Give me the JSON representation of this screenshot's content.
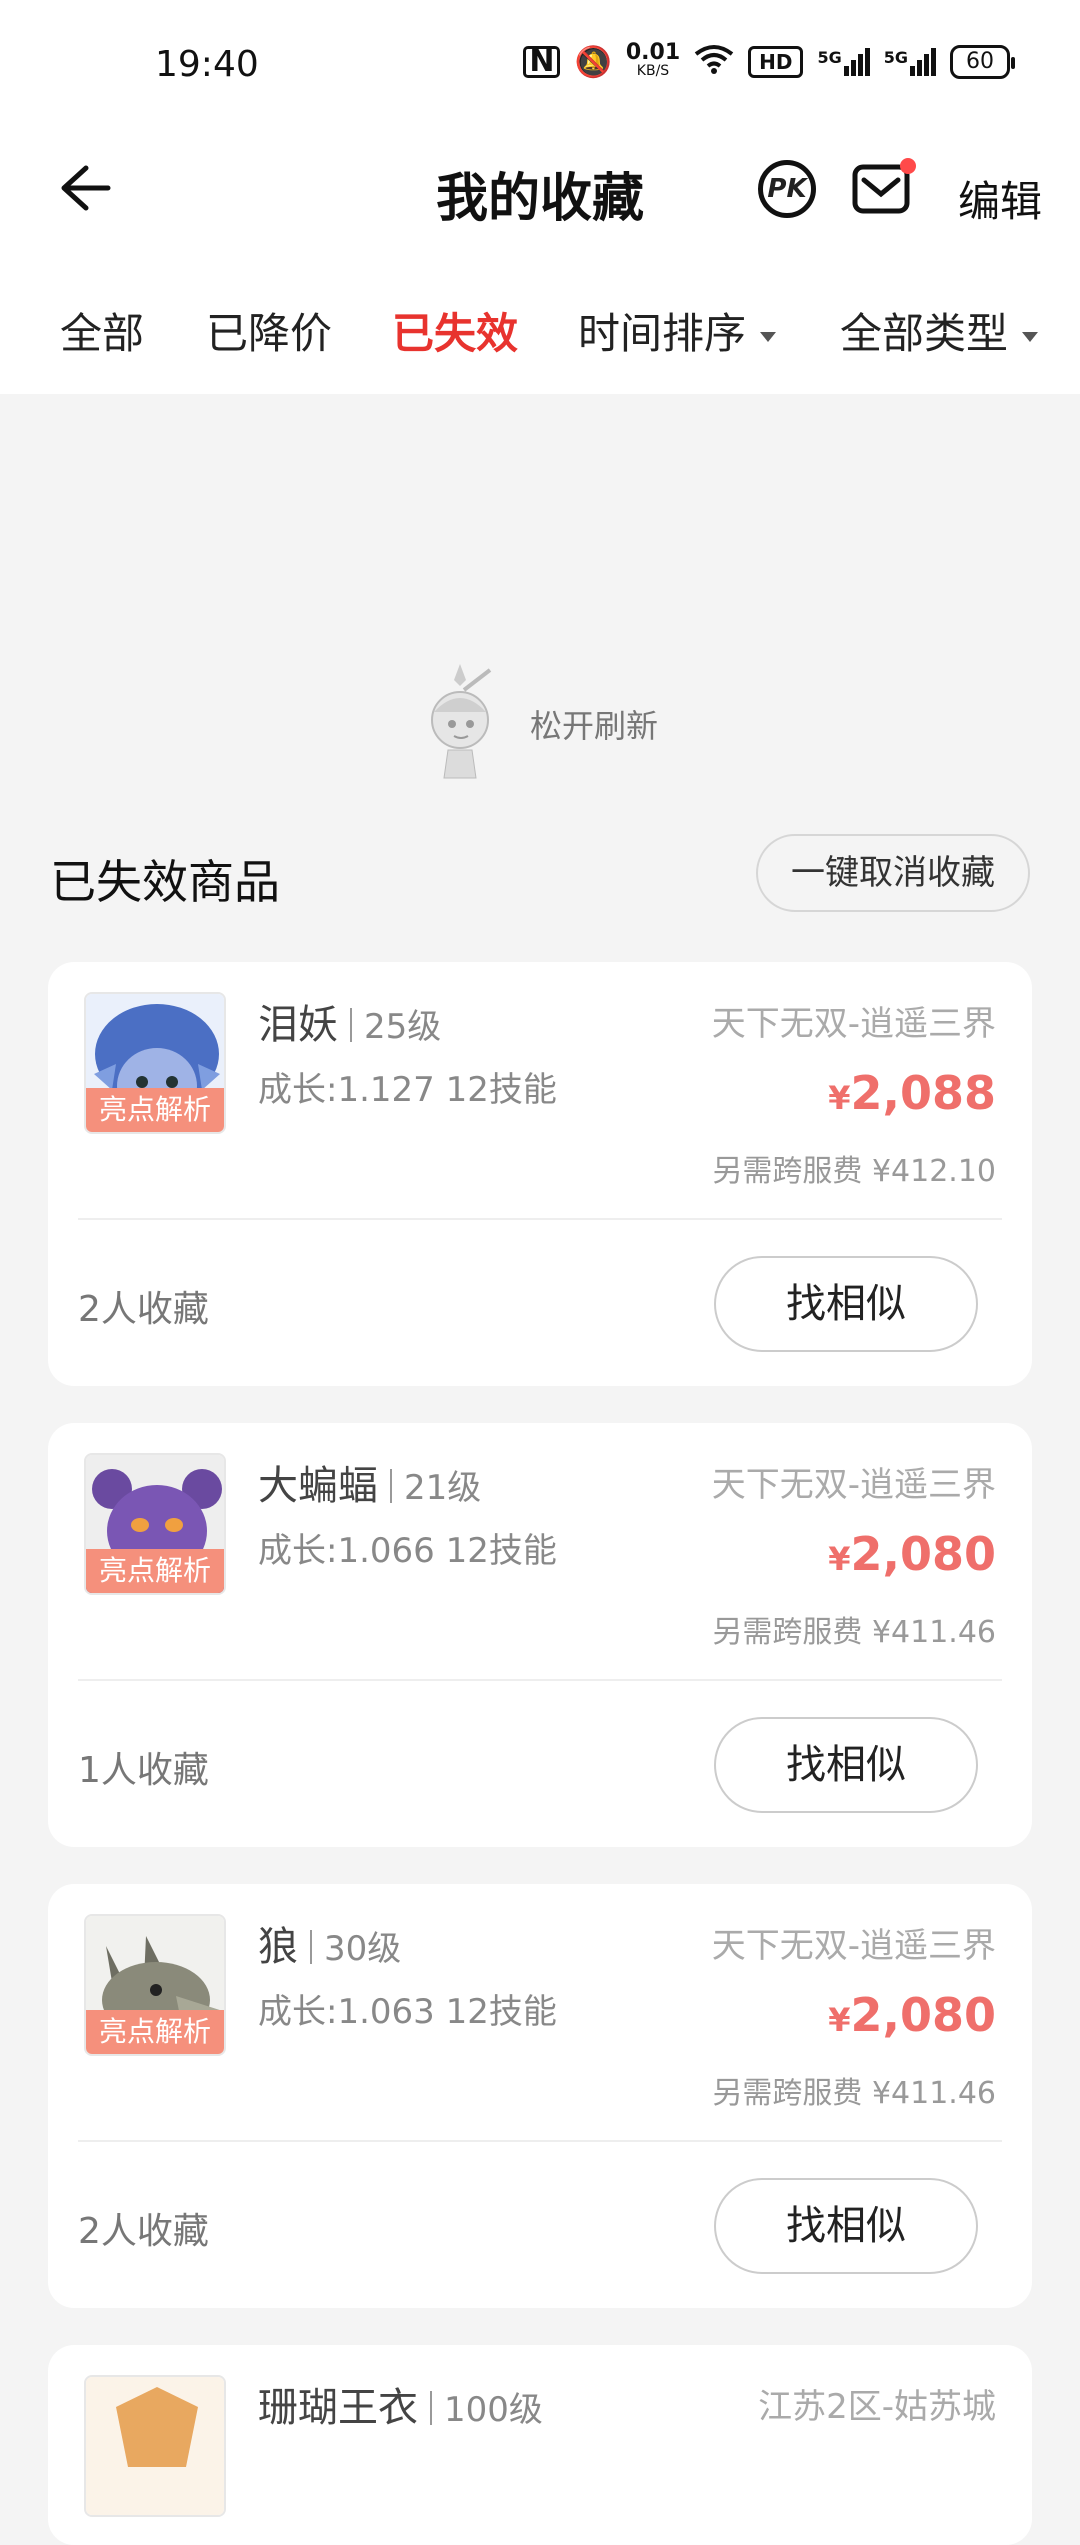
{
  "status_bar": {
    "time": "19:40",
    "net_speed_value": "0.01",
    "net_speed_unit": "KB/S",
    "hd_label": "HD",
    "signal1": "5G",
    "signal2": "5G",
    "battery": "60"
  },
  "header": {
    "title": "我的收藏",
    "pk_label": "PK",
    "edit_label": "编辑"
  },
  "tabs": [
    {
      "label": "全部",
      "active": false
    },
    {
      "label": "已降价",
      "active": false
    },
    {
      "label": "已失效",
      "active": true
    },
    {
      "label": "时间排序",
      "dropdown": true
    },
    {
      "label": "全部类型",
      "dropdown": true
    }
  ],
  "refresh": {
    "text": "松开刷新"
  },
  "section": {
    "title": "已失效商品",
    "cancel_all_label": "一键取消收藏"
  },
  "items": [
    {
      "name": "泪妖",
      "level": "25级",
      "stats": "成长:1.127 12技能",
      "server": "天下无双-逍遥三界",
      "currency": "¥",
      "price": "2,088",
      "fee": "另需跨服费 ¥412.10",
      "favorites": "2人收藏",
      "badge": "亮点解析",
      "button": "找相似"
    },
    {
      "name": "大蝙蝠",
      "level": "21级",
      "stats": "成长:1.066 12技能",
      "server": "天下无双-逍遥三界",
      "currency": "¥",
      "price": "2,080",
      "fee": "另需跨服费 ¥411.46",
      "favorites": "1人收藏",
      "badge": "亮点解析",
      "button": "找相似"
    },
    {
      "name": "狼",
      "level": "30级",
      "stats": "成长:1.063 12技能",
      "server": "天下无双-逍遥三界",
      "currency": "¥",
      "price": "2,080",
      "fee": "另需跨服费 ¥411.46",
      "favorites": "2人收藏",
      "badge": "亮点解析",
      "button": "找相似"
    },
    {
      "name": "珊瑚王衣",
      "level": "100级",
      "server": "江苏2区-姑苏城"
    }
  ],
  "colors": {
    "accent": "#e8332e",
    "price": "#ef6f6b",
    "badge": "#f5907c"
  }
}
